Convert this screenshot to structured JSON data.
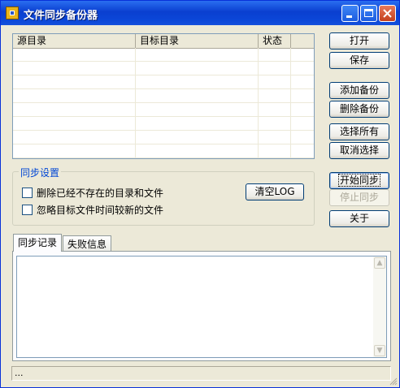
{
  "window": {
    "title": "文件同步备份器"
  },
  "list": {
    "columns": [
      "源目录",
      "目标目录",
      "状态"
    ],
    "rows": []
  },
  "buttons": {
    "open": "打开",
    "save": "保存",
    "add_backup": "添加备份",
    "delete_backup": "删除备份",
    "select_all": "选择所有",
    "deselect": "取消选择",
    "start_sync": "开始同步",
    "stop_sync": "停止同步",
    "about": "关于"
  },
  "sync_settings": {
    "label": "同步设置",
    "option_delete": {
      "label": "删除已经不存在的目录和文件",
      "checked": false
    },
    "option_ignore": {
      "label": "忽略目标文件时间较新的文件",
      "checked": false
    },
    "clear_log": "清空LOG"
  },
  "tabs": [
    {
      "label": "同步记录",
      "active": true
    },
    {
      "label": "失败信息",
      "active": false
    }
  ],
  "log": {
    "text": ""
  },
  "status": {
    "text": "..."
  },
  "colors": {
    "title_bar": "#0a3fd0",
    "group_label": "#0046d5",
    "window_bg": "#ece9d8"
  }
}
